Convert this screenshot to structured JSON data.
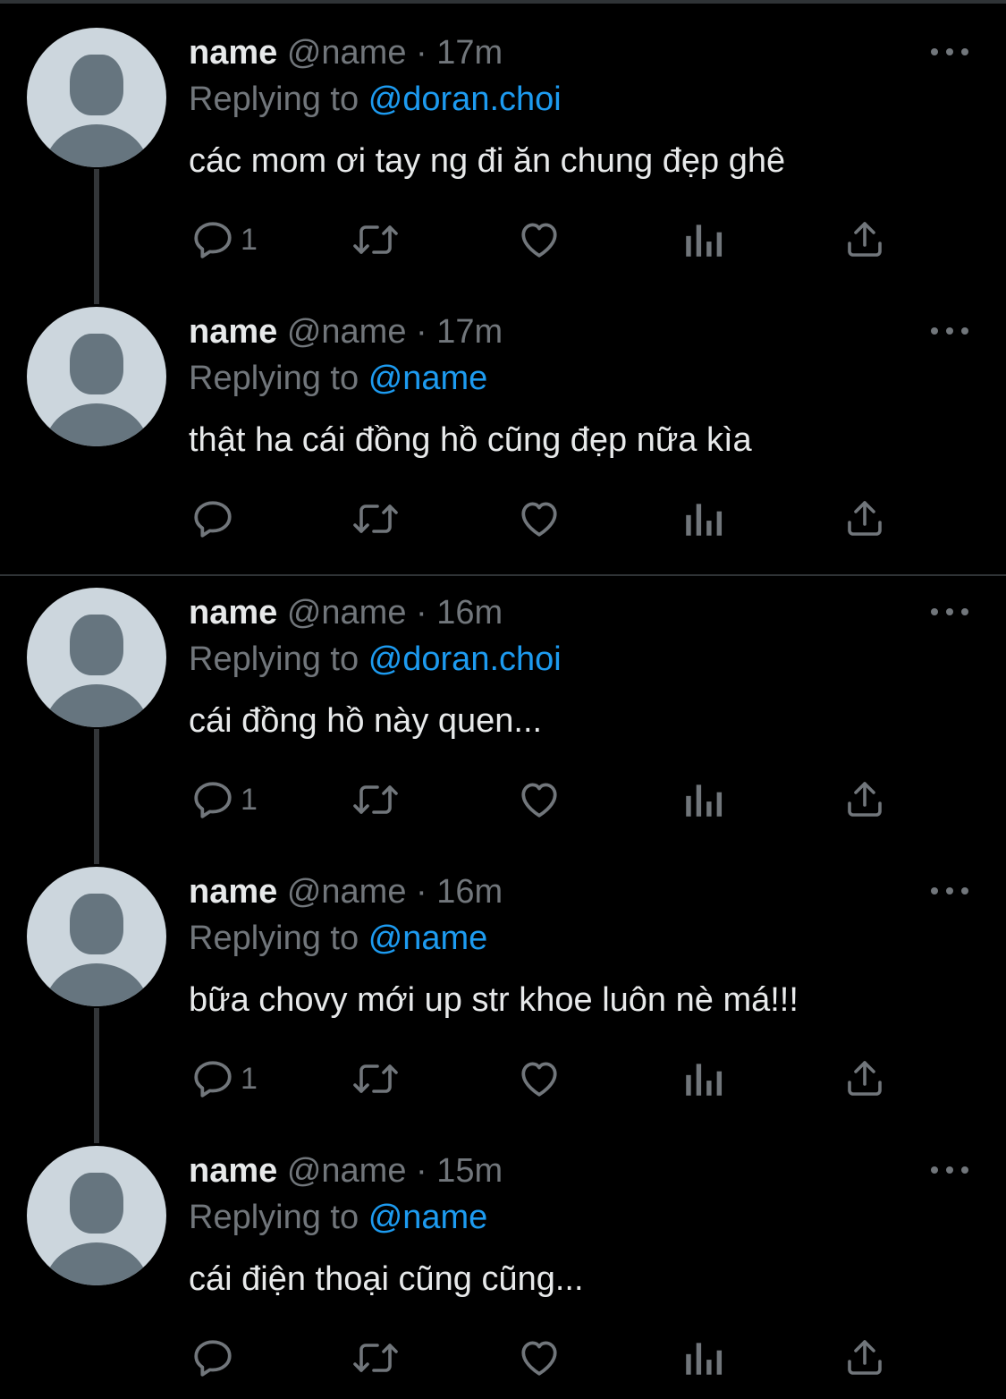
{
  "colors": {
    "background": "#000000",
    "text": "#e7e9ea",
    "secondary": "#71767b",
    "link": "#1d9bf0",
    "avatar_bg": "#ccd6dd",
    "avatar_fg": "#66757f"
  },
  "icons": {
    "reply": "speech-bubble-icon",
    "retweet": "retweet-icon",
    "like": "heart-icon",
    "views": "bar-chart-icon",
    "share": "share-icon",
    "more": "more-dots-icon"
  },
  "threads": [
    {
      "tweets": [
        {
          "display_name": "name",
          "handle": "@name",
          "dot": "·",
          "time": "17m",
          "reply_prefix": "Replying to",
          "reply_to": "@doran.choi",
          "text": "các mom ơi tay ng đi ăn chung đẹp ghê",
          "reply_count": "1"
        },
        {
          "display_name": "name",
          "handle": "@name",
          "dot": "·",
          "time": "17m",
          "reply_prefix": "Replying to",
          "reply_to": "@name",
          "text": "thật ha cái đồng hồ cũng đẹp nữa kìa",
          "reply_count": ""
        }
      ]
    },
    {
      "tweets": [
        {
          "display_name": "name",
          "handle": "@name",
          "dot": "·",
          "time": "16m",
          "reply_prefix": "Replying to",
          "reply_to": "@doran.choi",
          "text": "cái đồng hồ này quen...",
          "reply_count": "1"
        },
        {
          "display_name": "name",
          "handle": "@name",
          "dot": "·",
          "time": "16m",
          "reply_prefix": "Replying to",
          "reply_to": "@name",
          "text": "bữa chovy mới up str khoe luôn nè má!!!",
          "reply_count": "1"
        },
        {
          "display_name": "name",
          "handle": "@name",
          "dot": "·",
          "time": "15m",
          "reply_prefix": "Replying to",
          "reply_to": "@name",
          "text": "cái điện thoại cũng cũng...",
          "reply_count": ""
        }
      ]
    }
  ]
}
